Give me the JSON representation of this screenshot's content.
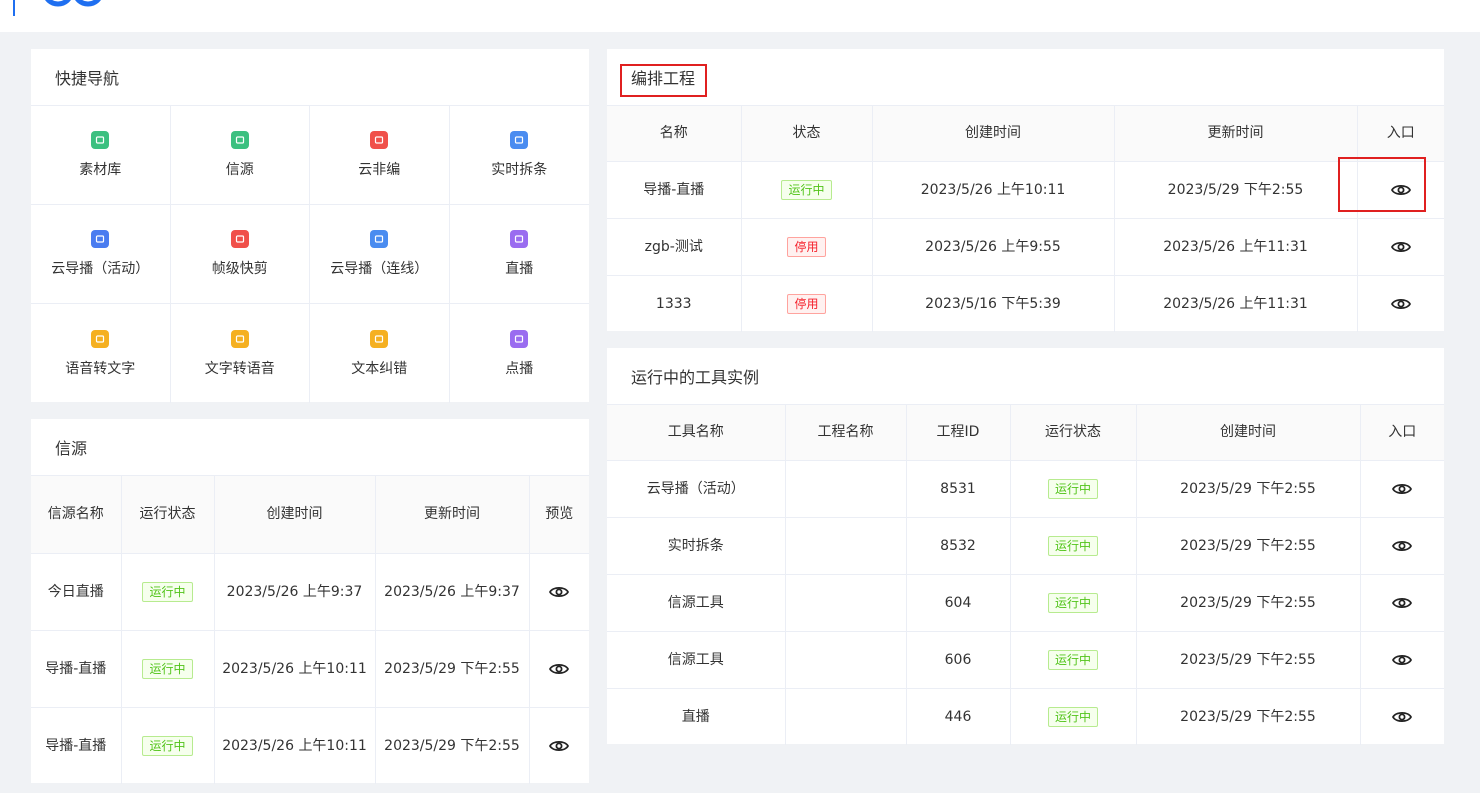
{
  "quick_nav": {
    "title": "快捷导航",
    "items": [
      {
        "label": "素材库",
        "icon": "material-library-icon",
        "color": "#3cc080"
      },
      {
        "label": "信源",
        "icon": "source-icon",
        "color": "#3cc080"
      },
      {
        "label": "云非编",
        "icon": "cloud-edit-icon",
        "color": "#f0504a"
      },
      {
        "label": "实时拆条",
        "icon": "realtime-split-icon",
        "color": "#4a8cf0"
      },
      {
        "label": "云导播（活动）",
        "icon": "cloud-director-icon",
        "color": "#4a7cf0"
      },
      {
        "label": "帧级快剪",
        "icon": "frame-cut-icon",
        "color": "#f0504a"
      },
      {
        "label": "云导播（连线）",
        "icon": "cloud-director-link-icon",
        "color": "#4a8cf0"
      },
      {
        "label": "直播",
        "icon": "live-icon",
        "color": "#9a6cf0"
      },
      {
        "label": "语音转文字",
        "icon": "speech-to-text-icon",
        "color": "#f5b021"
      },
      {
        "label": "文字转语音",
        "icon": "text-to-speech-icon",
        "color": "#f5b021"
      },
      {
        "label": "文本纠错",
        "icon": "text-correct-icon",
        "color": "#f5b021"
      },
      {
        "label": "点播",
        "icon": "vod-icon",
        "color": "#9a6cf0"
      }
    ]
  },
  "sources": {
    "title": "信源",
    "headers": [
      "信源名称",
      "运行状态",
      "创建时间",
      "更新时间",
      "预览"
    ],
    "rows": [
      {
        "name": "今日直播",
        "status": "运行中",
        "created": "2023/5/26 上午9:37",
        "updated": "2023/5/26 上午9:37"
      },
      {
        "name": "导播-直播",
        "status": "运行中",
        "created": "2023/5/26 上午10:11",
        "updated": "2023/5/29 下午2:55"
      },
      {
        "name": "导播-直播",
        "status": "运行中",
        "created": "2023/5/26 上午10:11",
        "updated": "2023/5/29 下午2:55"
      }
    ]
  },
  "projects": {
    "title": "编排工程",
    "headers": [
      "名称",
      "状态",
      "创建时间",
      "更新时间",
      "入口"
    ],
    "rows": [
      {
        "name": "导播-直播",
        "status": "运行中",
        "created": "2023/5/26 上午10:11",
        "updated": "2023/5/29 下午2:55"
      },
      {
        "name": "zgb-测试",
        "status": "停用",
        "created": "2023/5/26 上午9:55",
        "updated": "2023/5/26 上午11:31"
      },
      {
        "name": "1333",
        "status": "停用",
        "created": "2023/5/16 下午5:39",
        "updated": "2023/5/26 上午11:31"
      }
    ]
  },
  "tools": {
    "title": "运行中的工具实例",
    "headers": [
      "工具名称",
      "工程名称",
      "工程ID",
      "运行状态",
      "创建时间",
      "入口"
    ],
    "rows": [
      {
        "tool": "云导播（活动）",
        "project": "",
        "id": "8531",
        "status": "运行中",
        "created": "2023/5/29 下午2:55"
      },
      {
        "tool": "实时拆条",
        "project": "",
        "id": "8532",
        "status": "运行中",
        "created": "2023/5/29 下午2:55"
      },
      {
        "tool": "信源工具",
        "project": "",
        "id": "604",
        "status": "运行中",
        "created": "2023/5/29 下午2:55"
      },
      {
        "tool": "信源工具",
        "project": "",
        "id": "606",
        "status": "运行中",
        "created": "2023/5/29 下午2:55"
      },
      {
        "tool": "直播",
        "project": "",
        "id": "446",
        "status": "运行中",
        "created": "2023/5/29 下午2:55"
      }
    ]
  },
  "colors": {
    "accent": "#1f6ff0",
    "running": "#52c41a",
    "stopped": "#f5222d",
    "highlight": "#e02020"
  }
}
